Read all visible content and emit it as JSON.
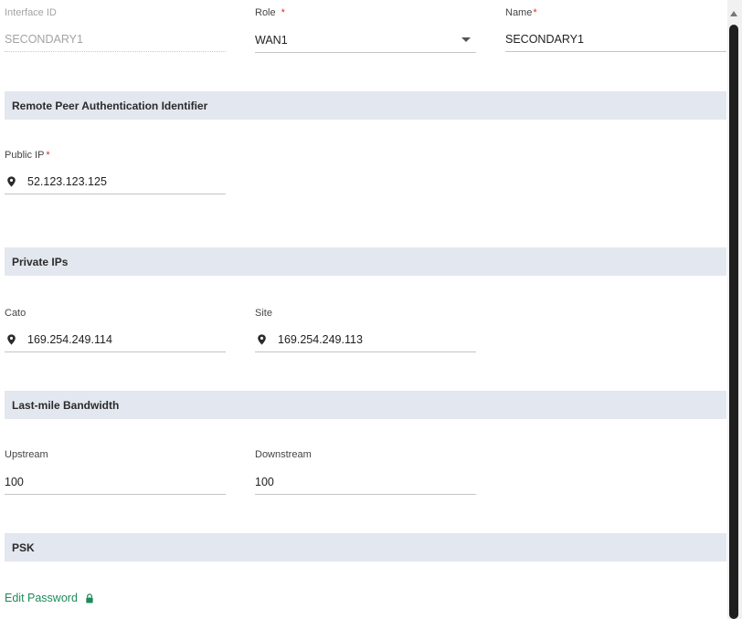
{
  "interface": {
    "interface_id_label": "Interface ID",
    "interface_id_value": "SECONDARY1",
    "role_label": "Role",
    "role_value": "WAN1",
    "name_label": "Name",
    "name_value": "SECONDARY1",
    "required_mark": "*"
  },
  "remote_peer": {
    "section_title": "Remote Peer Authentication Identifier",
    "public_ip_label": "Public IP",
    "public_ip_value": "52.123.123.125"
  },
  "private_ips": {
    "section_title": "Private IPs",
    "cato_label": "Cato",
    "cato_value": "169.254.249.114",
    "site_label": "Site",
    "site_value": "169.254.249.113"
  },
  "bandwidth": {
    "section_title": "Last-mile Bandwidth",
    "upstream_label": "Upstream",
    "upstream_value": "100",
    "downstream_label": "Downstream",
    "downstream_value": "100"
  },
  "psk": {
    "section_title": "PSK",
    "edit_password_label": "Edit Password"
  },
  "colors": {
    "section_bg": "#e3e7ef",
    "required": "#d32f2f",
    "link": "#1e8a5a"
  },
  "icons": [
    "location-pin-icon",
    "lock-icon",
    "chevron-down-icon"
  ]
}
